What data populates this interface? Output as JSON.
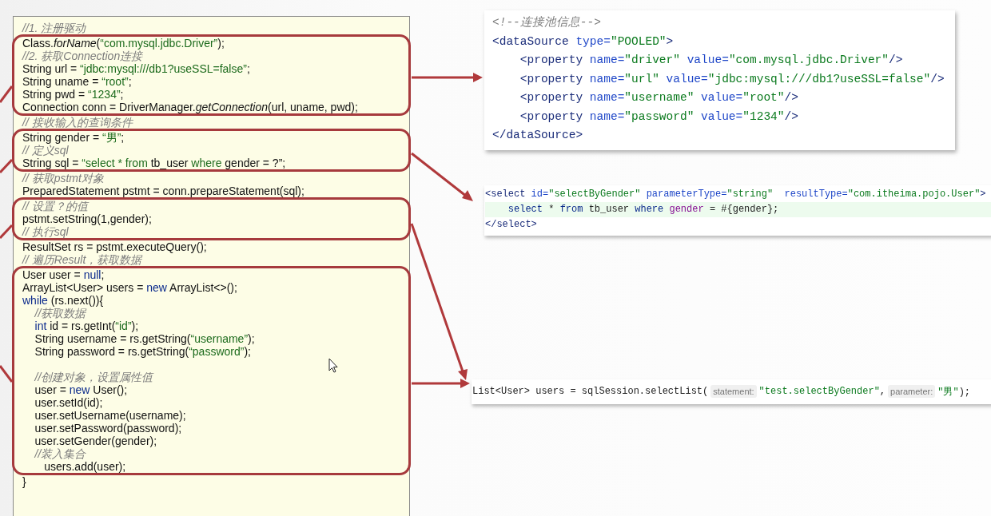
{
  "java_code": {
    "groups": [
      {
        "highlighted": false,
        "lines": [
          {
            "tokens": [
              {
                "kind": "comment",
                "text": "//1. 注册驱动"
              }
            ]
          }
        ]
      },
      {
        "highlighted": true,
        "lines": [
          {
            "tokens": [
              {
                "kind": "plain",
                "text": "Class."
              },
              {
                "kind": "italic",
                "text": "forName"
              },
              {
                "kind": "plain",
                "text": "("
              },
              {
                "kind": "string",
                "text": "“com.mysql.jdbc.Driver”"
              },
              {
                "kind": "plain",
                "text": ");"
              }
            ]
          },
          {
            "tokens": [
              {
                "kind": "comment",
                "text": "//2. 获取Connection连接"
              }
            ]
          },
          {
            "tokens": [
              {
                "kind": "plain",
                "text": "String url = "
              },
              {
                "kind": "string",
                "text": "“jdbc:mysql:///db1?useSSL=false”"
              },
              {
                "kind": "plain",
                "text": ";"
              }
            ]
          },
          {
            "tokens": [
              {
                "kind": "plain",
                "text": "String uname = "
              },
              {
                "kind": "string",
                "text": "“root”"
              },
              {
                "kind": "plain",
                "text": ";"
              }
            ]
          },
          {
            "tokens": [
              {
                "kind": "plain",
                "text": "String pwd = "
              },
              {
                "kind": "string",
                "text": "“1234”"
              },
              {
                "kind": "plain",
                "text": ";"
              }
            ]
          },
          {
            "tokens": [
              {
                "kind": "plain",
                "text": "Connection conn = DriverManager."
              },
              {
                "kind": "italic",
                "text": "getConnection"
              },
              {
                "kind": "plain",
                "text": "(url, uname, pwd);"
              }
            ]
          }
        ]
      },
      {
        "highlighted": false,
        "lines": [
          {
            "tokens": [
              {
                "kind": "comment",
                "text": "// 接收输入的查询条件"
              }
            ]
          }
        ]
      },
      {
        "highlighted": true,
        "lines": [
          {
            "tokens": [
              {
                "kind": "plain",
                "text": "String gender = "
              },
              {
                "kind": "string",
                "text": "“男”"
              },
              {
                "kind": "plain",
                "text": ";"
              }
            ]
          },
          {
            "tokens": [
              {
                "kind": "comment",
                "text": "// 定义sql"
              }
            ]
          },
          {
            "tokens": [
              {
                "kind": "plain",
                "text": "String sql = "
              },
              {
                "kind": "string",
                "text": "“select * from "
              },
              {
                "kind": "plain",
                "text": "tb_user "
              },
              {
                "kind": "string",
                "text": "where "
              },
              {
                "kind": "plain",
                "text": "gender = ?”;"
              }
            ]
          }
        ]
      },
      {
        "highlighted": false,
        "lines": [
          {
            "tokens": [
              {
                "kind": "comment",
                "text": "// 获取pstmt对象"
              }
            ]
          },
          {
            "tokens": [
              {
                "kind": "plain",
                "text": "PreparedStatement pstmt = conn.prepareStatement(sql);"
              }
            ]
          }
        ]
      },
      {
        "highlighted": true,
        "lines": [
          {
            "tokens": [
              {
                "kind": "comment",
                "text": "// 设置？的值"
              }
            ]
          },
          {
            "tokens": [
              {
                "kind": "plain",
                "text": "pstmt.setString(1,gender);"
              }
            ]
          },
          {
            "tokens": [
              {
                "kind": "comment",
                "text": "// 执行sql"
              }
            ]
          }
        ]
      },
      {
        "highlighted": false,
        "lines": [
          {
            "tokens": [
              {
                "kind": "plain",
                "text": "ResultSet rs = pstmt.executeQuery();"
              }
            ]
          },
          {
            "tokens": [
              {
                "kind": "comment",
                "text": "// 遍历Result，获取数据"
              }
            ]
          }
        ]
      },
      {
        "highlighted": true,
        "lines": [
          {
            "tokens": [
              {
                "kind": "plain",
                "text": "User user = "
              },
              {
                "kind": "keyword",
                "text": "null"
              },
              {
                "kind": "plain",
                "text": ";"
              }
            ]
          },
          {
            "tokens": [
              {
                "kind": "plain",
                "text": "ArrayList<User> users = "
              },
              {
                "kind": "keyword",
                "text": "new"
              },
              {
                "kind": "plain",
                "text": " ArrayList<>();"
              }
            ]
          },
          {
            "tokens": [
              {
                "kind": "keyword",
                "text": "while"
              },
              {
                "kind": "plain",
                "text": " (rs.next()){"
              }
            ]
          },
          {
            "tokens": [
              {
                "kind": "comment",
                "text": "    //获取数据"
              }
            ]
          },
          {
            "tokens": [
              {
                "kind": "keyword",
                "text": "    int"
              },
              {
                "kind": "plain",
                "text": " id = rs.getInt("
              },
              {
                "kind": "string",
                "text": "“id”"
              },
              {
                "kind": "plain",
                "text": ");"
              }
            ]
          },
          {
            "tokens": [
              {
                "kind": "plain",
                "text": "    String username = rs.getString("
              },
              {
                "kind": "string",
                "text": "“username”"
              },
              {
                "kind": "plain",
                "text": ");"
              }
            ]
          },
          {
            "tokens": [
              {
                "kind": "plain",
                "text": "    String password = rs.getString("
              },
              {
                "kind": "string",
                "text": "“password”"
              },
              {
                "kind": "plain",
                "text": ");"
              }
            ]
          },
          {
            "gap_before": true,
            "tokens": [
              {
                "kind": "comment",
                "text": "    //创建对象，设置属性值"
              }
            ]
          },
          {
            "tokens": [
              {
                "kind": "plain",
                "text": "    user = "
              },
              {
                "kind": "keyword",
                "text": "new"
              },
              {
                "kind": "plain",
                "text": " User();"
              }
            ]
          },
          {
            "tokens": [
              {
                "kind": "plain",
                "text": "    user.setId(id);"
              }
            ]
          },
          {
            "tokens": [
              {
                "kind": "plain",
                "text": "    user.setUsername(username);"
              }
            ]
          },
          {
            "tokens": [
              {
                "kind": "plain",
                "text": "    user.setPassword(password);"
              }
            ]
          },
          {
            "tokens": [
              {
                "kind": "plain",
                "text": "    user.setGender(gender);"
              }
            ]
          },
          {
            "tokens": [
              {
                "kind": "comment",
                "text": "    //装入集合"
              }
            ]
          },
          {
            "tokens": [
              {
                "kind": "plain",
                "text": "       users.add(user);"
              }
            ]
          }
        ]
      },
      {
        "highlighted": false,
        "lines": [
          {
            "tokens": [
              {
                "kind": "plain",
                "text": "}"
              }
            ]
          }
        ]
      }
    ]
  },
  "datasource_xml": {
    "lines": [
      {
        "tokens": [
          {
            "kind": "comment",
            "text": "<!--连接池信息-->"
          }
        ]
      },
      {
        "tokens": [
          {
            "kind": "tag",
            "text": "<dataSource "
          },
          {
            "kind": "attr",
            "text": "type="
          },
          {
            "kind": "value",
            "text": "\"POOLED\""
          },
          {
            "kind": "tag",
            "text": ">"
          }
        ]
      },
      {
        "tokens": [
          {
            "kind": "tag",
            "text": "    <property "
          },
          {
            "kind": "attr",
            "text": "name="
          },
          {
            "kind": "value",
            "text": "\"driver\" "
          },
          {
            "kind": "attr",
            "text": "value="
          },
          {
            "kind": "value",
            "text": "\"com.mysql.jdbc.Driver\""
          },
          {
            "kind": "tag",
            "text": "/>"
          }
        ]
      },
      {
        "tokens": [
          {
            "kind": "tag",
            "text": "    <property "
          },
          {
            "kind": "attr",
            "text": "name="
          },
          {
            "kind": "value",
            "text": "\"url\" "
          },
          {
            "kind": "attr",
            "text": "value="
          },
          {
            "kind": "value",
            "text": "\"jdbc:mysql:///db1?useSSL=false\""
          },
          {
            "kind": "tag",
            "text": "/>"
          }
        ]
      },
      {
        "tokens": [
          {
            "kind": "tag",
            "text": "    <property "
          },
          {
            "kind": "attr",
            "text": "name="
          },
          {
            "kind": "value",
            "text": "\"username\" "
          },
          {
            "kind": "attr",
            "text": "value="
          },
          {
            "kind": "value",
            "text": "\"root\""
          },
          {
            "kind": "tag",
            "text": "/>"
          }
        ]
      },
      {
        "tokens": [
          {
            "kind": "tag",
            "text": "    <property "
          },
          {
            "kind": "attr",
            "text": "name="
          },
          {
            "kind": "value",
            "text": "\"password\" "
          },
          {
            "kind": "attr",
            "text": "value="
          },
          {
            "kind": "value",
            "text": "\"1234\""
          },
          {
            "kind": "tag",
            "text": "/>"
          }
        ]
      },
      {
        "tokens": [
          {
            "kind": "tag",
            "text": "</dataSource>"
          }
        ]
      }
    ]
  },
  "select_xml": {
    "lines": [
      {
        "highlighted": false,
        "tokens": [
          {
            "kind": "tag",
            "text": "<select "
          },
          {
            "kind": "attr",
            "text": "id="
          },
          {
            "kind": "value",
            "text": "\"selectByGender\" "
          },
          {
            "kind": "attr",
            "text": "parameterType="
          },
          {
            "kind": "value",
            "text": "\"string\"  "
          },
          {
            "kind": "attr",
            "text": "resultType="
          },
          {
            "kind": "value",
            "text": "\"com.itheima.pojo.User\""
          },
          {
            "kind": "tag",
            "text": ">"
          }
        ]
      },
      {
        "highlighted": true,
        "tokens": [
          {
            "kind": "keyword",
            "text": "    select"
          },
          {
            "kind": "plain",
            "text": " * "
          },
          {
            "kind": "keyword",
            "text": "from"
          },
          {
            "kind": "plain",
            "text": " tb_user "
          },
          {
            "kind": "keyword",
            "text": "where"
          },
          {
            "kind": "field",
            "text": " gender"
          },
          {
            "kind": "plain",
            "text": " = #{gender};"
          }
        ]
      },
      {
        "highlighted": false,
        "tokens": [
          {
            "kind": "tag",
            "text": "</select>"
          }
        ]
      }
    ]
  },
  "select_list_call": {
    "parts": [
      {
        "kind": "code",
        "tokens": [
          {
            "kind": "plain",
            "text": "List<User> users = sqlSession.selectList("
          }
        ]
      },
      {
        "kind": "hint",
        "text": "statement:"
      },
      {
        "kind": "code",
        "tokens": [
          {
            "kind": "value",
            "text": "\"test.selectByGender\""
          },
          {
            "kind": "plain",
            "text": ","
          }
        ]
      },
      {
        "kind": "hint",
        "text": "parameter:"
      },
      {
        "kind": "code",
        "tokens": [
          {
            "kind": "value",
            "text": "\"男\""
          },
          {
            "kind": "plain",
            "text": ");"
          }
        ]
      }
    ]
  }
}
